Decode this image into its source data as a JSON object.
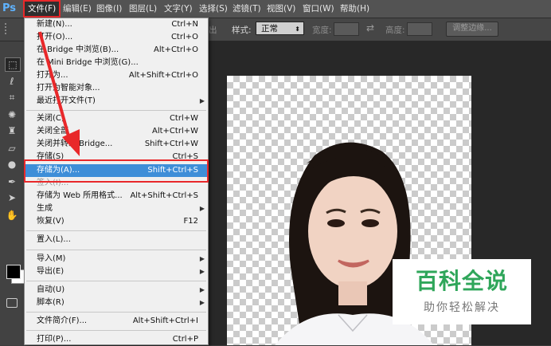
{
  "app": {
    "logo": "Ps"
  },
  "menubar": {
    "items": [
      {
        "label": "文件(F)"
      },
      {
        "label": "编辑(E)"
      },
      {
        "label": "图像(I)"
      },
      {
        "label": "图层(L)"
      },
      {
        "label": "文字(Y)"
      },
      {
        "label": "选择(S)"
      },
      {
        "label": "滤镜(T)"
      },
      {
        "label": "视图(V)"
      },
      {
        "label": "窗口(W)"
      },
      {
        "label": "帮助(H)"
      }
    ]
  },
  "optionsbar": {
    "feather_partial": "出",
    "style_label": "样式:",
    "style_value": "正常",
    "width_label": "宽度:",
    "height_label": "高度:",
    "refine_edge_label": "调整边缘..."
  },
  "file_menu": {
    "items": [
      {
        "label": "新建(N)...",
        "shortcut": "Ctrl+N"
      },
      {
        "label": "打开(O)...",
        "shortcut": "Ctrl+O"
      },
      {
        "label": "在 Bridge 中浏览(B)...",
        "shortcut": "Alt+Ctrl+O"
      },
      {
        "label": "在 Mini Bridge 中浏览(G)...",
        "shortcut": ""
      },
      {
        "label": "打开为...",
        "shortcut": "Alt+Shift+Ctrl+O"
      },
      {
        "label": "打开为智能对象...",
        "shortcut": ""
      },
      {
        "label": "最近打开文件(T)",
        "shortcut": ""
      },
      {
        "label": "关闭(C)",
        "shortcut": "Ctrl+W"
      },
      {
        "label": "关闭全部",
        "shortcut": "Alt+Ctrl+W"
      },
      {
        "label": "关闭并转到 Bridge...",
        "shortcut": "Shift+Ctrl+W"
      },
      {
        "label": "存储(S)",
        "shortcut": "Ctrl+S"
      },
      {
        "label": "存储为(A)...",
        "shortcut": "Shift+Ctrl+S"
      },
      {
        "label": "签入(I)...",
        "shortcut": ""
      },
      {
        "label": "存储为 Web 所用格式...",
        "shortcut": "Alt+Shift+Ctrl+S"
      },
      {
        "label": "生成",
        "shortcut": ""
      },
      {
        "label": "恢复(V)",
        "shortcut": "F12"
      },
      {
        "label": "置入(L)...",
        "shortcut": ""
      },
      {
        "label": "导入(M)",
        "shortcut": ""
      },
      {
        "label": "导出(E)",
        "shortcut": ""
      },
      {
        "label": "自动(U)",
        "shortcut": ""
      },
      {
        "label": "脚本(R)",
        "shortcut": ""
      },
      {
        "label": "文件简介(F)...",
        "shortcut": "Alt+Shift+Ctrl+I"
      },
      {
        "label": "打印(P)...",
        "shortcut": "Ctrl+P"
      }
    ]
  },
  "watermark": {
    "title": "百科全说",
    "subtitle": "助你轻松解决"
  },
  "colors": {
    "highlight": "#3e8ed8",
    "annotation_red": "#e8282a",
    "watermark_green": "#2fa65a"
  }
}
